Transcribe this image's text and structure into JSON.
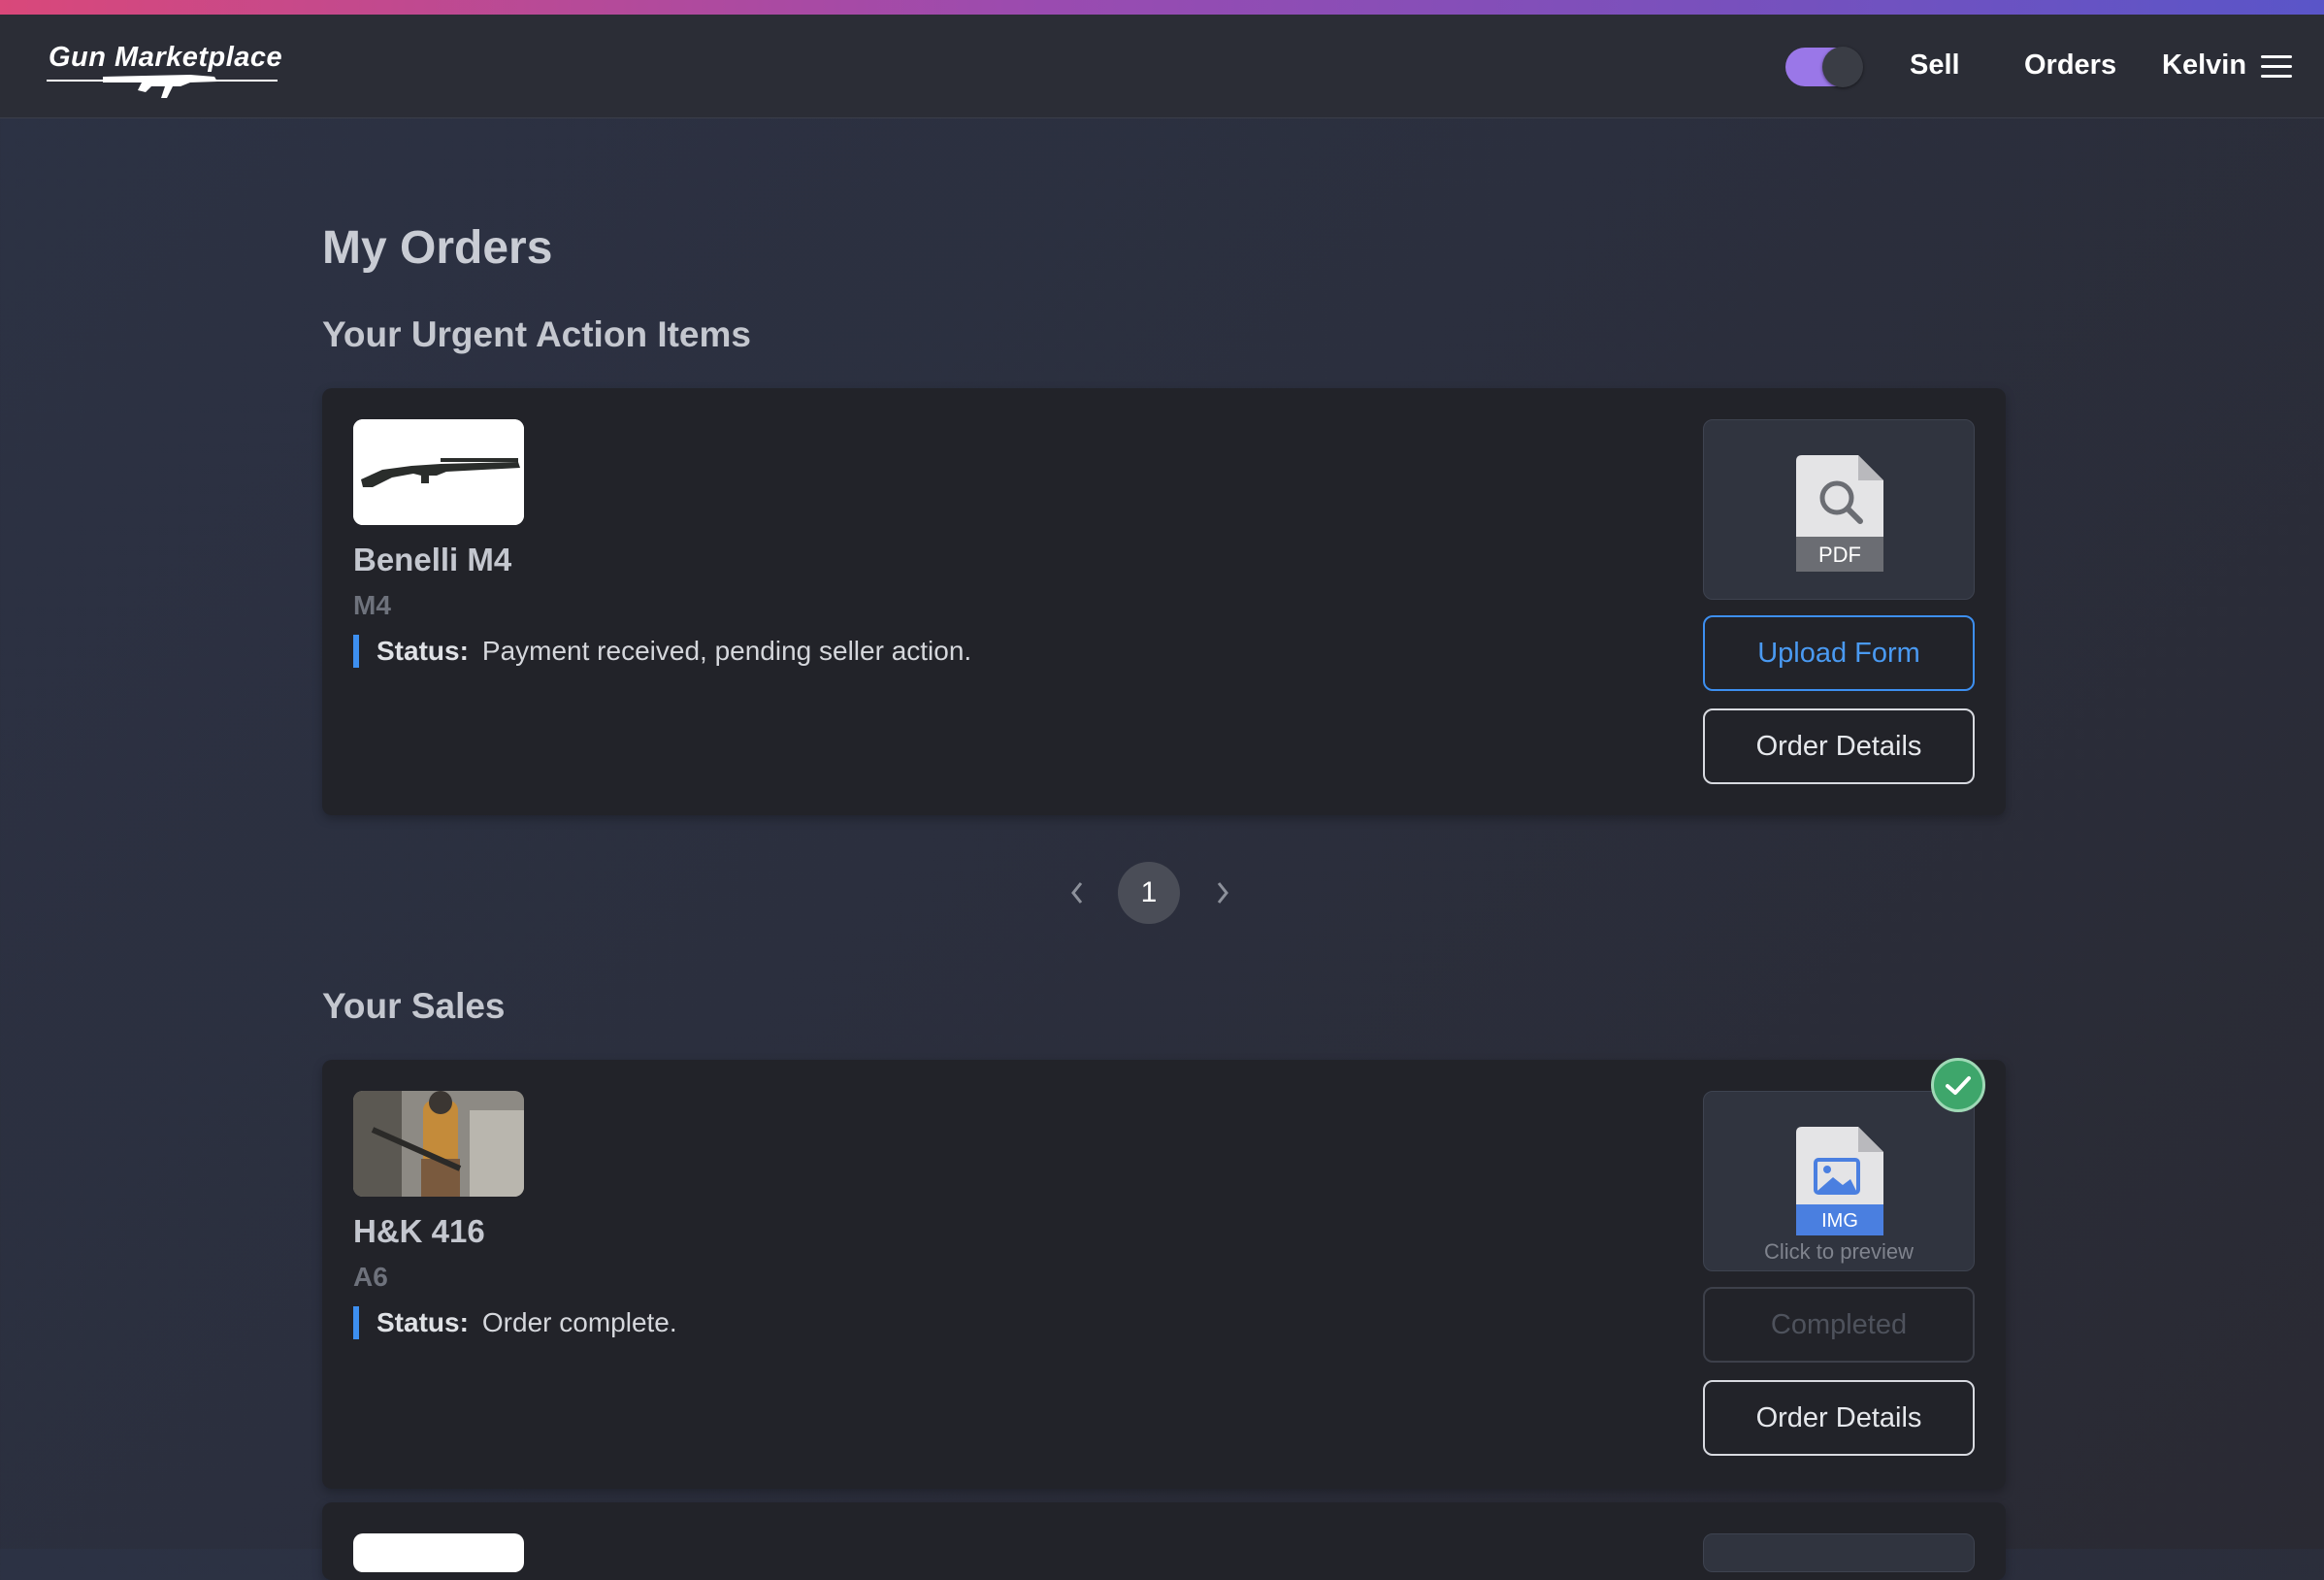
{
  "header": {
    "logo_text": "Gun Marketplace",
    "nav": {
      "sell": "Sell",
      "orders": "Orders",
      "user": "Kelvin"
    },
    "theme_toggle_on": true
  },
  "page": {
    "title": "My Orders",
    "urgent_title": "Your Urgent Action Items",
    "sales_title": "Your Sales"
  },
  "urgent_items": [
    {
      "name": "Benelli M4",
      "model": "M4",
      "status_label": "Status:",
      "status_text": "Payment received, pending seller action.",
      "doc_type": "PDF",
      "primary_button": "Upload Form",
      "secondary_button": "Order Details"
    }
  ],
  "pagination": {
    "current": "1",
    "prev_icon": "chevron-left-icon",
    "next_icon": "chevron-right-icon"
  },
  "sales": [
    {
      "name": "H&K 416",
      "model": "A6",
      "status_label": "Status:",
      "status_text": "Order complete.",
      "doc_type": "IMG",
      "doc_hint": "Click to preview",
      "primary_button": "Completed",
      "secondary_button": "Order Details",
      "verified_icon": "check-icon"
    }
  ],
  "colors": {
    "accent_blue": "#3d8ff0",
    "toggle_purple": "#9a77e8",
    "success_green": "#3ea66b",
    "card_bg": "#222329"
  }
}
